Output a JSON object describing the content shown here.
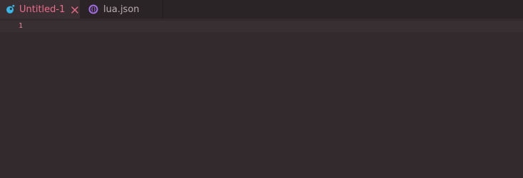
{
  "tabs": [
    {
      "label": "Untitled-1",
      "active": true,
      "icon": "lua-file-icon",
      "close_icon": "close-icon"
    },
    {
      "label": "lua.json",
      "active": false,
      "icon": "json-file-icon"
    }
  ],
  "editor": {
    "line_numbers": [
      "1"
    ],
    "content": ""
  },
  "colors": {
    "editor_background": "#322a2d",
    "tabbar_background": "#2b2427",
    "active_tab_background": "#3a3034",
    "active_tab_text": "#ee6b8a",
    "inactive_tab_text": "#b9aeb2",
    "line_number": "#e8839a",
    "current_line_highlight": "#382f33"
  }
}
